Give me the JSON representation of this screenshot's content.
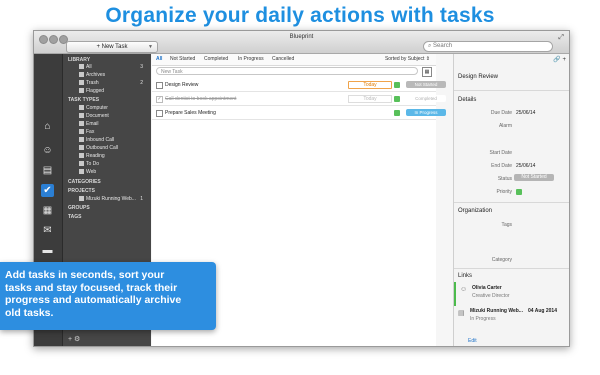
{
  "headline": "Organize your daily actions with tasks",
  "window": {
    "title": "Blueprint",
    "new_task_label": "+ New Task",
    "search_placeholder": "Search"
  },
  "sidebar": {
    "sections": {
      "library": "LIBRARY",
      "task_types": "TASK TYPES",
      "categories": "CATEGORIES",
      "projects": "PROJECTS",
      "groups": "GROUPS",
      "tags": "TAGS"
    },
    "library_items": [
      {
        "label": "All",
        "count": "3"
      },
      {
        "label": "Archives",
        "count": ""
      },
      {
        "label": "Trash",
        "count": "2"
      },
      {
        "label": "Flagged",
        "count": ""
      }
    ],
    "task_types": [
      "Computer",
      "Document",
      "Email",
      "Fax",
      "Inbound Call",
      "Outbound Call",
      "Reading",
      "To Do",
      "Web"
    ],
    "projects": [
      {
        "label": "Mizuki Running Web...",
        "count": "1"
      }
    ],
    "bottom_controls": "+  ⚙"
  },
  "tabs": [
    "All",
    "Not Started",
    "Completed",
    "In Progress",
    "Cancelled"
  ],
  "sorted_by": "Sorted by Subject",
  "new_task_placeholder": "New Task",
  "tasks": [
    {
      "title": "Design Review",
      "due": "Today",
      "status": "Not Started",
      "status_color": "#b9b9b9"
    },
    {
      "title": "Call dentist to book appointment",
      "due": "Today",
      "status": "Completed",
      "status_color": "#ffffff"
    },
    {
      "title": "Prepare Sales Meeting",
      "due": "",
      "status": "In Progress",
      "status_color": "#5bb8e8"
    }
  ],
  "detail": {
    "task_title": "Design Review",
    "details_header": "Details",
    "due_date_label": "Due Date",
    "due_date_value": "25/06/14",
    "alarm_label": "Alarm",
    "start_date_label": "Start Date",
    "end_date_label": "End Date",
    "end_date_value": "25/06/14",
    "status_label": "Status",
    "status_value": "Not Started",
    "priority_label": "Priority",
    "organization_header": "Organization",
    "tags_label": "Tags",
    "category_label": "Category",
    "links_header": "Links",
    "links": [
      {
        "name": "Olivia Carter",
        "sub": "Creative Director",
        "date": ""
      },
      {
        "name": "Mizuki Running Web...",
        "sub": "In Progress",
        "date": "04 Aug 2014"
      }
    ],
    "edit_label": "Edit"
  },
  "promo": {
    "line1": "Add tasks in seconds, sort your",
    "line2": "tasks and stay focused, track their",
    "line3": "progress and automatically archive",
    "line4": "old tasks."
  }
}
